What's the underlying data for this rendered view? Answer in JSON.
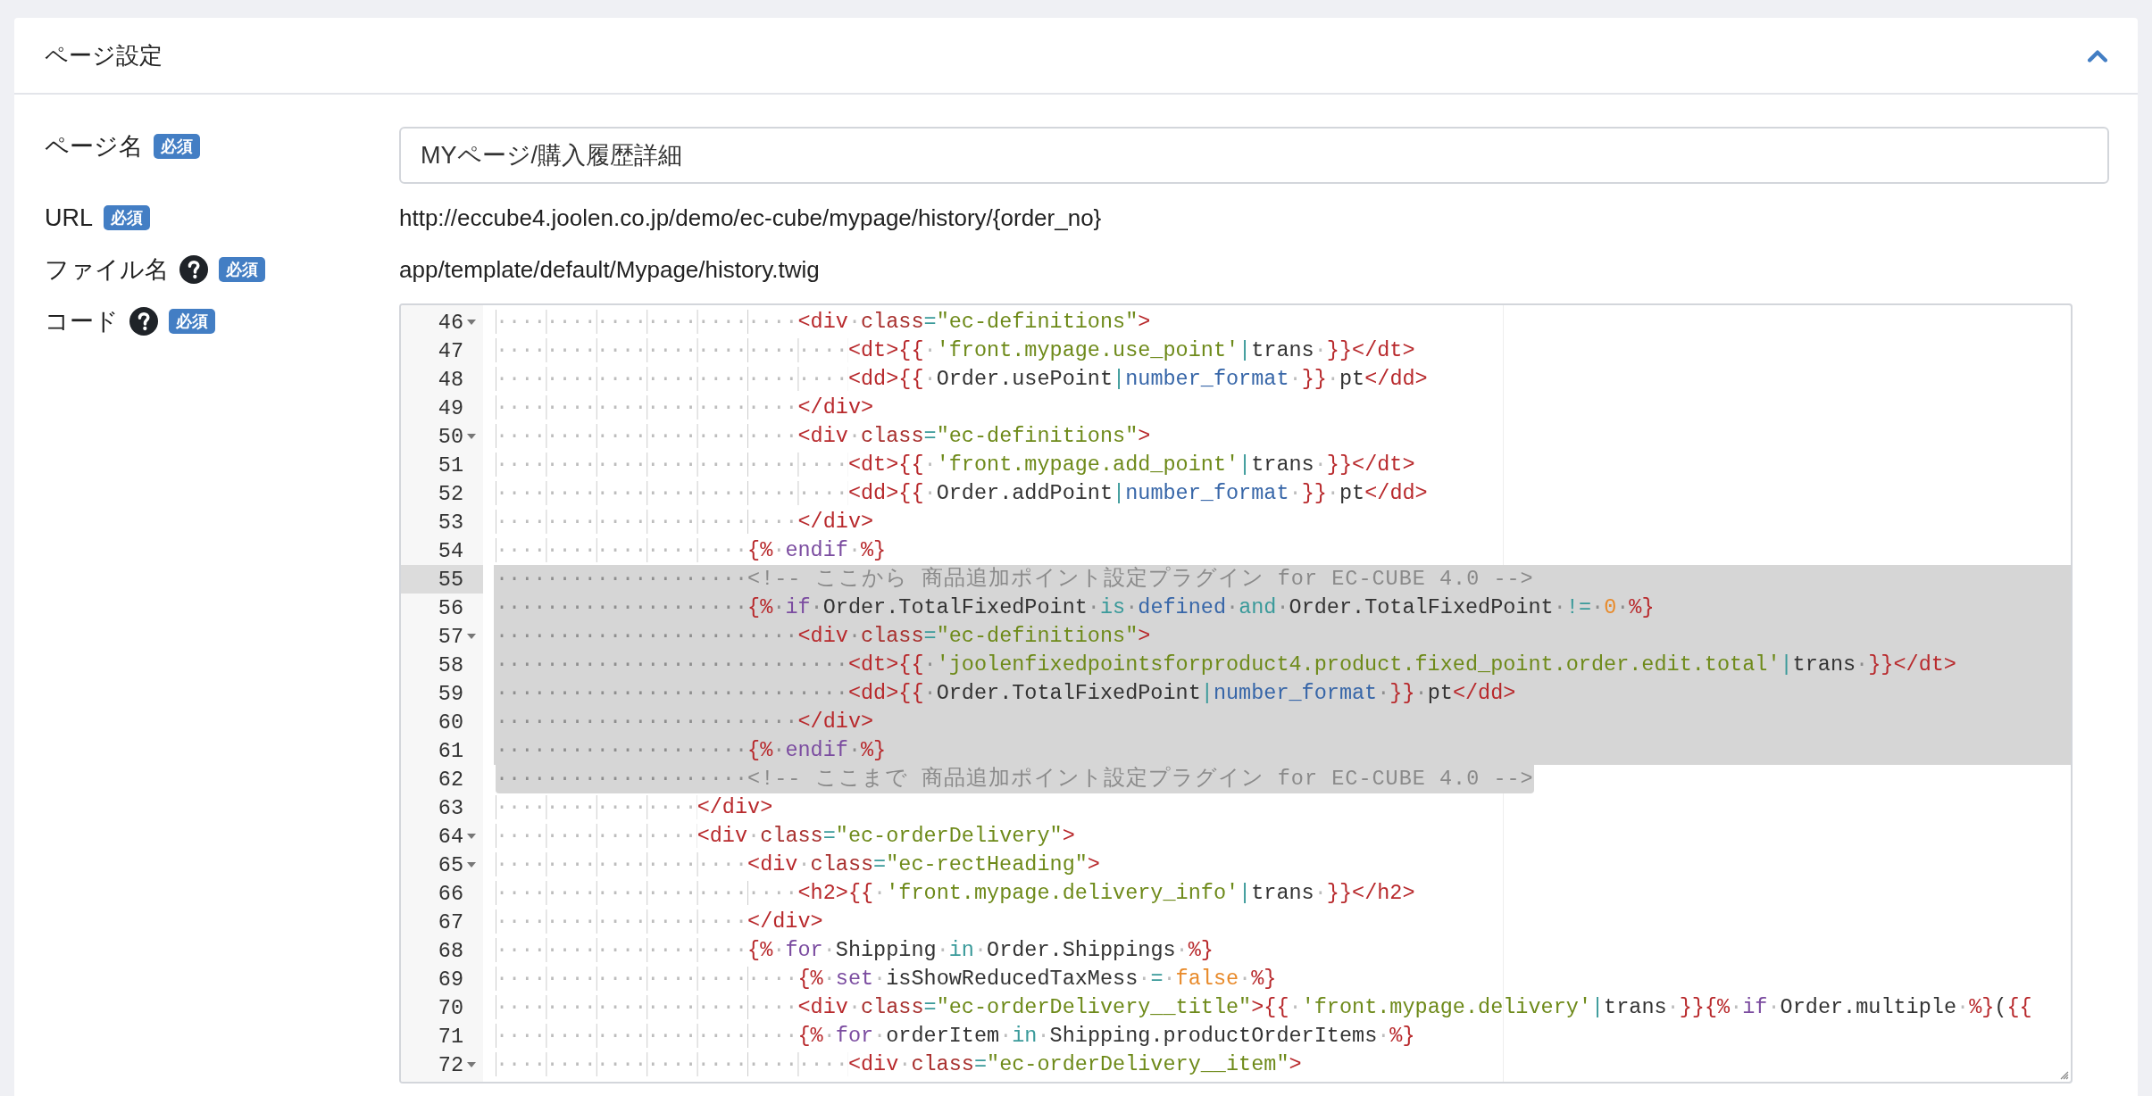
{
  "panel": {
    "title": "ページ設定",
    "expanded": true
  },
  "fields": [
    {
      "kind": "input",
      "label": "ページ名",
      "badge": "必須",
      "help": false,
      "value": "MYページ/購入履歴詳細"
    },
    {
      "kind": "text",
      "label": "URL",
      "badge": "必須",
      "help": false,
      "value": "http://eccube4.joolen.co.jp/demo/ec-cube/mypage/history/{order_no}"
    },
    {
      "kind": "text",
      "label": "ファイル名",
      "badge": "必須",
      "help": true,
      "value": "app/template/default/Mypage/history.twig"
    },
    {
      "kind": "code",
      "label": "コード",
      "badge": "必須",
      "help": true
    }
  ],
  "code_editor": {
    "lines": [
      {
        "number": "46",
        "foldable": true,
        "active": false,
        "selected": false,
        "tokens": [
          {
            "kind": "ws",
            "text": "························"
          },
          {
            "kind": "tag",
            "text": "<div"
          },
          {
            "kind": "sp",
            "text": "·"
          },
          {
            "kind": "attr",
            "text": "class"
          },
          {
            "kind": "op",
            "text": "="
          },
          {
            "kind": "str",
            "text": "\"ec-definitions\""
          },
          {
            "kind": "tag",
            "text": ">"
          }
        ]
      },
      {
        "number": "47",
        "foldable": false,
        "active": false,
        "selected": false,
        "tokens": [
          {
            "kind": "ws",
            "text": "····························"
          },
          {
            "kind": "tag",
            "text": "<dt>"
          },
          {
            "kind": "delim",
            "text": "{{"
          },
          {
            "kind": "sp",
            "text": "·"
          },
          {
            "kind": "str",
            "text": "'front.mypage.use_point'"
          },
          {
            "kind": "op",
            "text": "|"
          },
          {
            "kind": "plain",
            "text": "trans"
          },
          {
            "kind": "sp",
            "text": "·"
          },
          {
            "kind": "delim",
            "text": "}}"
          },
          {
            "kind": "tag",
            "text": "</dt>"
          }
        ]
      },
      {
        "number": "48",
        "foldable": false,
        "active": false,
        "selected": false,
        "tokens": [
          {
            "kind": "ws",
            "text": "····························"
          },
          {
            "kind": "tag",
            "text": "<dd>"
          },
          {
            "kind": "delim",
            "text": "{{"
          },
          {
            "kind": "sp",
            "text": "·"
          },
          {
            "kind": "plain",
            "text": "Order.usePoint"
          },
          {
            "kind": "op",
            "text": "|"
          },
          {
            "kind": "fn",
            "text": "number_format"
          },
          {
            "kind": "sp",
            "text": "·"
          },
          {
            "kind": "delim",
            "text": "}}"
          },
          {
            "kind": "sp",
            "text": "·"
          },
          {
            "kind": "plain",
            "text": "pt"
          },
          {
            "kind": "tag",
            "text": "</dd>"
          }
        ]
      },
      {
        "number": "49",
        "foldable": false,
        "active": false,
        "selected": false,
        "tokens": [
          {
            "kind": "ws",
            "text": "························"
          },
          {
            "kind": "tag",
            "text": "</div>"
          }
        ]
      },
      {
        "number": "50",
        "foldable": true,
        "active": false,
        "selected": false,
        "tokens": [
          {
            "kind": "ws",
            "text": "························"
          },
          {
            "kind": "tag",
            "text": "<div"
          },
          {
            "kind": "sp",
            "text": "·"
          },
          {
            "kind": "attr",
            "text": "class"
          },
          {
            "kind": "op",
            "text": "="
          },
          {
            "kind": "str",
            "text": "\"ec-definitions\""
          },
          {
            "kind": "tag",
            "text": ">"
          }
        ]
      },
      {
        "number": "51",
        "foldable": false,
        "active": false,
        "selected": false,
        "tokens": [
          {
            "kind": "ws",
            "text": "····························"
          },
          {
            "kind": "tag",
            "text": "<dt>"
          },
          {
            "kind": "delim",
            "text": "{{"
          },
          {
            "kind": "sp",
            "text": "·"
          },
          {
            "kind": "str",
            "text": "'front.mypage.add_point'"
          },
          {
            "kind": "op",
            "text": "|"
          },
          {
            "kind": "plain",
            "text": "trans"
          },
          {
            "kind": "sp",
            "text": "·"
          },
          {
            "kind": "delim",
            "text": "}}"
          },
          {
            "kind": "tag",
            "text": "</dt>"
          }
        ]
      },
      {
        "number": "52",
        "foldable": false,
        "active": false,
        "selected": false,
        "tokens": [
          {
            "kind": "ws",
            "text": "····························"
          },
          {
            "kind": "tag",
            "text": "<dd>"
          },
          {
            "kind": "delim",
            "text": "{{"
          },
          {
            "kind": "sp",
            "text": "·"
          },
          {
            "kind": "plain",
            "text": "Order.addPoint"
          },
          {
            "kind": "op",
            "text": "|"
          },
          {
            "kind": "fn",
            "text": "number_format"
          },
          {
            "kind": "sp",
            "text": "·"
          },
          {
            "kind": "delim",
            "text": "}}"
          },
          {
            "kind": "sp",
            "text": "·"
          },
          {
            "kind": "plain",
            "text": "pt"
          },
          {
            "kind": "tag",
            "text": "</dd>"
          }
        ]
      },
      {
        "number": "53",
        "foldable": false,
        "active": false,
        "selected": false,
        "tokens": [
          {
            "kind": "ws",
            "text": "························"
          },
          {
            "kind": "tag",
            "text": "</div>"
          }
        ]
      },
      {
        "number": "54",
        "foldable": false,
        "active": false,
        "selected": false,
        "tokens": [
          {
            "kind": "ws",
            "text": "····················"
          },
          {
            "kind": "delim",
            "text": "{%"
          },
          {
            "kind": "sp",
            "text": "·"
          },
          {
            "kind": "kw",
            "text": "endif"
          },
          {
            "kind": "sp",
            "text": "·"
          },
          {
            "kind": "delim",
            "text": "%}"
          }
        ]
      },
      {
        "number": "55",
        "foldable": false,
        "active": true,
        "selected": true,
        "tokens": [
          {
            "kind": "ws",
            "text": "····················"
          },
          {
            "kind": "comment",
            "text": "<!-- ここから 商品追加ポイント設定プラグイン for EC-CUBE 4.0 -->"
          }
        ]
      },
      {
        "number": "56",
        "foldable": false,
        "active": false,
        "selected": true,
        "tokens": [
          {
            "kind": "ws",
            "text": "····················"
          },
          {
            "kind": "delim",
            "text": "{%"
          },
          {
            "kind": "sp",
            "text": "·"
          },
          {
            "kind": "kw",
            "text": "if"
          },
          {
            "kind": "sp",
            "text": "·"
          },
          {
            "kind": "plain",
            "text": "Order.TotalFixedPoint"
          },
          {
            "kind": "sp",
            "text": "·"
          },
          {
            "kind": "op",
            "text": "is"
          },
          {
            "kind": "sp",
            "text": "·"
          },
          {
            "kind": "fn",
            "text": "defined"
          },
          {
            "kind": "sp",
            "text": "·"
          },
          {
            "kind": "op",
            "text": "and"
          },
          {
            "kind": "sp",
            "text": "·"
          },
          {
            "kind": "plain",
            "text": "Order.TotalFixedPoint"
          },
          {
            "kind": "sp",
            "text": "·"
          },
          {
            "kind": "op",
            "text": "!="
          },
          {
            "kind": "sp",
            "text": "·"
          },
          {
            "kind": "num",
            "text": "0"
          },
          {
            "kind": "sp",
            "text": "·"
          },
          {
            "kind": "delim",
            "text": "%}"
          }
        ]
      },
      {
        "number": "57",
        "foldable": true,
        "active": false,
        "selected": true,
        "tokens": [
          {
            "kind": "ws",
            "text": "························"
          },
          {
            "kind": "tag",
            "text": "<div"
          },
          {
            "kind": "sp",
            "text": "·"
          },
          {
            "kind": "attr",
            "text": "class"
          },
          {
            "kind": "op",
            "text": "="
          },
          {
            "kind": "str",
            "text": "\"ec-definitions\""
          },
          {
            "kind": "tag",
            "text": ">"
          }
        ]
      },
      {
        "number": "58",
        "foldable": false,
        "active": false,
        "selected": true,
        "tokens": [
          {
            "kind": "ws",
            "text": "····························"
          },
          {
            "kind": "tag",
            "text": "<dt>"
          },
          {
            "kind": "delim",
            "text": "{{"
          },
          {
            "kind": "sp",
            "text": "·"
          },
          {
            "kind": "str",
            "text": "'joolenfixedpointsforproduct4.product.fixed_point.order.edit.total'"
          },
          {
            "kind": "op",
            "text": "|"
          },
          {
            "kind": "plain",
            "text": "trans"
          },
          {
            "kind": "sp",
            "text": "·"
          },
          {
            "kind": "delim",
            "text": "}}"
          },
          {
            "kind": "tag",
            "text": "</dt>"
          }
        ]
      },
      {
        "number": "59",
        "foldable": false,
        "active": false,
        "selected": true,
        "tokens": [
          {
            "kind": "ws",
            "text": "····························"
          },
          {
            "kind": "tag",
            "text": "<dd>"
          },
          {
            "kind": "delim",
            "text": "{{"
          },
          {
            "kind": "sp",
            "text": "·"
          },
          {
            "kind": "plain",
            "text": "Order.TotalFixedPoint"
          },
          {
            "kind": "op",
            "text": "|"
          },
          {
            "kind": "fn",
            "text": "number_format"
          },
          {
            "kind": "sp",
            "text": "·"
          },
          {
            "kind": "delim",
            "text": "}}"
          },
          {
            "kind": "sp",
            "text": "·"
          },
          {
            "kind": "plain",
            "text": "pt"
          },
          {
            "kind": "tag",
            "text": "</dd>"
          }
        ]
      },
      {
        "number": "60",
        "foldable": false,
        "active": false,
        "selected": true,
        "tokens": [
          {
            "kind": "ws",
            "text": "························"
          },
          {
            "kind": "tag",
            "text": "</div>"
          }
        ]
      },
      {
        "number": "61",
        "foldable": false,
        "active": false,
        "selected": true,
        "tokens": [
          {
            "kind": "ws",
            "text": "····················"
          },
          {
            "kind": "delim",
            "text": "{%"
          },
          {
            "kind": "sp",
            "text": "·"
          },
          {
            "kind": "kw",
            "text": "endif"
          },
          {
            "kind": "sp",
            "text": "·"
          },
          {
            "kind": "delim",
            "text": "%}"
          }
        ]
      },
      {
        "number": "62",
        "foldable": false,
        "active": false,
        "selected": true,
        "tokens": [
          {
            "kind": "ws",
            "text": "····················"
          },
          {
            "kind": "comment",
            "text": "<!-- ここまで 商品追加ポイント設定プラグイン for EC-CUBE 4.0 -->"
          }
        ]
      },
      {
        "number": "63",
        "foldable": false,
        "active": false,
        "selected": false,
        "tokens": [
          {
            "kind": "ws",
            "text": "················"
          },
          {
            "kind": "tag",
            "text": "</div>"
          }
        ]
      },
      {
        "number": "64",
        "foldable": true,
        "active": false,
        "selected": false,
        "tokens": [
          {
            "kind": "ws",
            "text": "················"
          },
          {
            "kind": "tag",
            "text": "<div"
          },
          {
            "kind": "sp",
            "text": "·"
          },
          {
            "kind": "attr",
            "text": "class"
          },
          {
            "kind": "op",
            "text": "="
          },
          {
            "kind": "str",
            "text": "\"ec-orderDelivery\""
          },
          {
            "kind": "tag",
            "text": ">"
          }
        ]
      },
      {
        "number": "65",
        "foldable": true,
        "active": false,
        "selected": false,
        "tokens": [
          {
            "kind": "ws",
            "text": "····················"
          },
          {
            "kind": "tag",
            "text": "<div"
          },
          {
            "kind": "sp",
            "text": "·"
          },
          {
            "kind": "attr",
            "text": "class"
          },
          {
            "kind": "op",
            "text": "="
          },
          {
            "kind": "str",
            "text": "\"ec-rectHeading\""
          },
          {
            "kind": "tag",
            "text": ">"
          }
        ]
      },
      {
        "number": "66",
        "foldable": false,
        "active": false,
        "selected": false,
        "tokens": [
          {
            "kind": "ws",
            "text": "························"
          },
          {
            "kind": "tag",
            "text": "<h2>"
          },
          {
            "kind": "delim",
            "text": "{{"
          },
          {
            "kind": "sp",
            "text": "·"
          },
          {
            "kind": "str",
            "text": "'front.mypage.delivery_info'"
          },
          {
            "kind": "op",
            "text": "|"
          },
          {
            "kind": "plain",
            "text": "trans"
          },
          {
            "kind": "sp",
            "text": "·"
          },
          {
            "kind": "delim",
            "text": "}}"
          },
          {
            "kind": "tag",
            "text": "</h2>"
          }
        ]
      },
      {
        "number": "67",
        "foldable": false,
        "active": false,
        "selected": false,
        "tokens": [
          {
            "kind": "ws",
            "text": "····················"
          },
          {
            "kind": "tag",
            "text": "</div>"
          }
        ]
      },
      {
        "number": "68",
        "foldable": false,
        "active": false,
        "selected": false,
        "tokens": [
          {
            "kind": "ws",
            "text": "····················"
          },
          {
            "kind": "delim",
            "text": "{%"
          },
          {
            "kind": "sp",
            "text": "·"
          },
          {
            "kind": "kw",
            "text": "for"
          },
          {
            "kind": "sp",
            "text": "·"
          },
          {
            "kind": "plain",
            "text": "Shipping"
          },
          {
            "kind": "sp",
            "text": "·"
          },
          {
            "kind": "op",
            "text": "in"
          },
          {
            "kind": "sp",
            "text": "·"
          },
          {
            "kind": "plain",
            "text": "Order.Shippings"
          },
          {
            "kind": "sp",
            "text": "·"
          },
          {
            "kind": "delim",
            "text": "%}"
          }
        ]
      },
      {
        "number": "69",
        "foldable": false,
        "active": false,
        "selected": false,
        "tokens": [
          {
            "kind": "ws",
            "text": "························"
          },
          {
            "kind": "delim",
            "text": "{%"
          },
          {
            "kind": "sp",
            "text": "·"
          },
          {
            "kind": "kw",
            "text": "set"
          },
          {
            "kind": "sp",
            "text": "·"
          },
          {
            "kind": "plain",
            "text": "isShowReducedTaxMess"
          },
          {
            "kind": "sp",
            "text": "·"
          },
          {
            "kind": "op",
            "text": "="
          },
          {
            "kind": "sp",
            "text": "·"
          },
          {
            "kind": "num",
            "text": "false"
          },
          {
            "kind": "sp",
            "text": "·"
          },
          {
            "kind": "delim",
            "text": "%}"
          }
        ]
      },
      {
        "number": "70",
        "foldable": false,
        "active": false,
        "selected": false,
        "tokens": [
          {
            "kind": "ws",
            "text": "························"
          },
          {
            "kind": "tag",
            "text": "<div"
          },
          {
            "kind": "sp",
            "text": "·"
          },
          {
            "kind": "attr",
            "text": "class"
          },
          {
            "kind": "op",
            "text": "="
          },
          {
            "kind": "str",
            "text": "\"ec-orderDelivery__title\""
          },
          {
            "kind": "tag",
            "text": ">"
          },
          {
            "kind": "delim",
            "text": "{{"
          },
          {
            "kind": "sp",
            "text": "·"
          },
          {
            "kind": "str",
            "text": "'front.mypage.delivery'"
          },
          {
            "kind": "op",
            "text": "|"
          },
          {
            "kind": "plain",
            "text": "trans"
          },
          {
            "kind": "sp",
            "text": "·"
          },
          {
            "kind": "delim",
            "text": "}}{%"
          },
          {
            "kind": "sp",
            "text": "·"
          },
          {
            "kind": "kw",
            "text": "if"
          },
          {
            "kind": "sp",
            "text": "·"
          },
          {
            "kind": "plain",
            "text": "Order.multiple"
          },
          {
            "kind": "sp",
            "text": "·"
          },
          {
            "kind": "delim",
            "text": "%}"
          },
          {
            "kind": "plain",
            "text": "("
          },
          {
            "kind": "delim",
            "text": "{{"
          }
        ]
      },
      {
        "number": "71",
        "foldable": false,
        "active": false,
        "selected": false,
        "tokens": [
          {
            "kind": "ws",
            "text": "························"
          },
          {
            "kind": "delim",
            "text": "{%"
          },
          {
            "kind": "sp",
            "text": "·"
          },
          {
            "kind": "kw",
            "text": "for"
          },
          {
            "kind": "sp",
            "text": "·"
          },
          {
            "kind": "plain",
            "text": "orderItem"
          },
          {
            "kind": "sp",
            "text": "·"
          },
          {
            "kind": "op",
            "text": "in"
          },
          {
            "kind": "sp",
            "text": "·"
          },
          {
            "kind": "plain",
            "text": "Shipping.productOrderItems"
          },
          {
            "kind": "sp",
            "text": "·"
          },
          {
            "kind": "delim",
            "text": "%}"
          }
        ]
      },
      {
        "number": "72",
        "foldable": true,
        "active": false,
        "selected": false,
        "tokens": [
          {
            "kind": "ws",
            "text": "····························"
          },
          {
            "kind": "tag",
            "text": "<div"
          },
          {
            "kind": "sp",
            "text": "·"
          },
          {
            "kind": "attr",
            "text": "class"
          },
          {
            "kind": "op",
            "text": "="
          },
          {
            "kind": "str",
            "text": "\"ec-orderDelivery__item\""
          },
          {
            "kind": "tag",
            "text": ">"
          }
        ]
      }
    ]
  }
}
